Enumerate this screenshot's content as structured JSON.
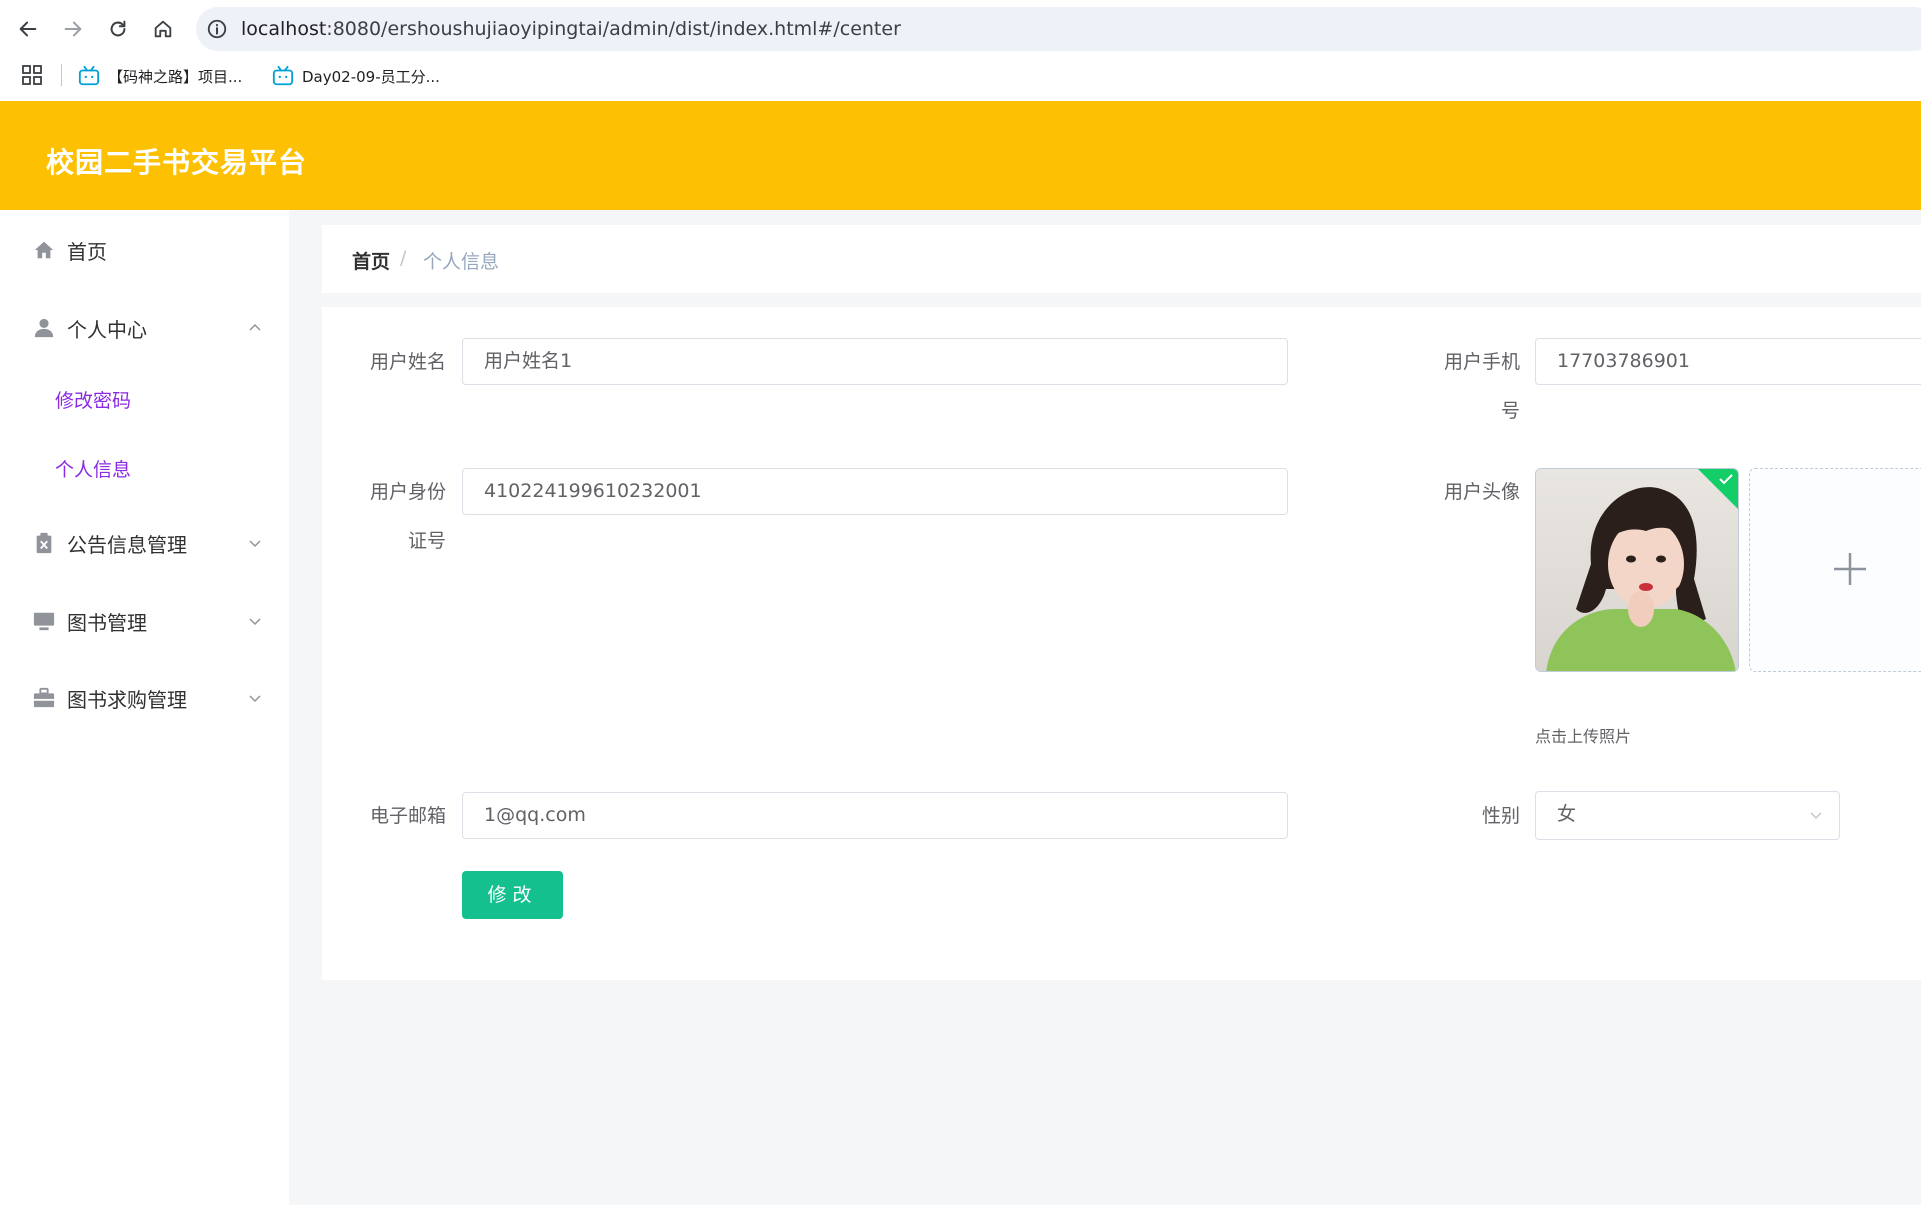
{
  "browser": {
    "url_host": "localhost",
    "url_rest": ":8080/ershoushujiaoyipingtai/admin/dist/index.html#/center",
    "bookmarks": [
      {
        "label": "【码神之路】项目..."
      },
      {
        "label": "Day02-09-员工分..."
      }
    ]
  },
  "app": {
    "title": "校园二手书交易平台",
    "accent_color": "#fdc003"
  },
  "sidebar": {
    "items": [
      {
        "label": "首页",
        "icon": "home-icon"
      },
      {
        "label": "个人中心",
        "icon": "user-icon",
        "expanded": true,
        "children": [
          {
            "label": "修改密码"
          },
          {
            "label": "个人信息"
          }
        ]
      },
      {
        "label": "公告信息管理",
        "icon": "clipboard-icon"
      },
      {
        "label": "图书管理",
        "icon": "monitor-icon"
      },
      {
        "label": "图书求购管理",
        "icon": "briefcase-icon"
      }
    ]
  },
  "breadcrumb": {
    "home": "首页",
    "separator": "/",
    "current": "个人信息"
  },
  "form": {
    "username": {
      "label": "用户姓名",
      "value": "用户姓名1"
    },
    "phone": {
      "label_line1": "用户手机",
      "label_line2": "号",
      "value": "17703786901"
    },
    "idcard": {
      "label_line1": "用户身份",
      "label_line2": "证号",
      "value": "410224199610232001"
    },
    "avatar": {
      "label": "用户头像",
      "tip": "点击上传照片"
    },
    "email": {
      "label": "电子邮箱",
      "value": "1@qq.com"
    },
    "gender": {
      "label": "性别",
      "value": "女"
    },
    "submit_label": "修改",
    "submit_color": "#13c08e"
  }
}
